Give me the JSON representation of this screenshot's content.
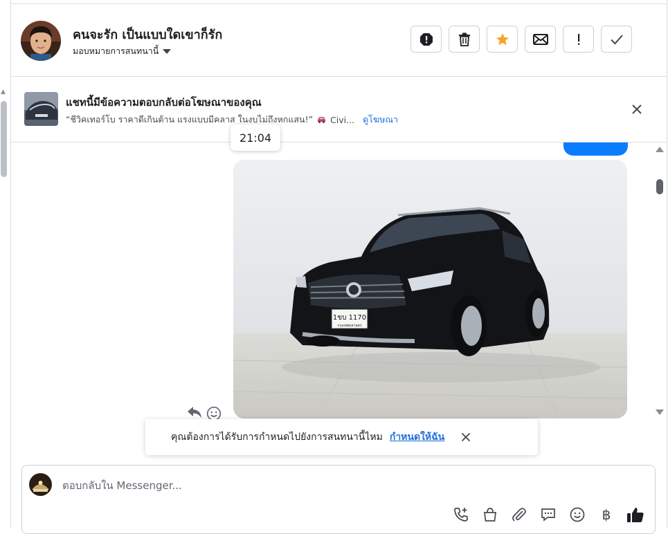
{
  "header": {
    "contact_name": "คนจะรัก เป็นแบบใดเขาก็รัก",
    "assign_label": "มอบหมายการสนทนานี้",
    "actions": [
      {
        "name": "spam",
        "icon": "alert-circle-icon"
      },
      {
        "name": "delete",
        "icon": "trash-icon"
      },
      {
        "name": "star",
        "icon": "star-icon"
      },
      {
        "name": "mark-unread",
        "icon": "envelope-icon"
      },
      {
        "name": "follow-up",
        "icon": "exclamation-icon"
      },
      {
        "name": "done",
        "icon": "check-icon"
      }
    ]
  },
  "ad_banner": {
    "title": "แชทนี้มีข้อความตอบกลับต่อโฆษณาของคุณ",
    "quote": "“ชีวิคเทอร์โบ ราคาดีเกินต้าน แรงแบบมีคลาส ในงบไม่ถึงหกแสน!”",
    "quote_suffix": "Civi...",
    "link": "ดูโฆษณา"
  },
  "conversation": {
    "timestamp": "21:04",
    "photo_plate": "1ขบ 1170",
    "photo_plate_sub": "กรุงเทพมหานคร"
  },
  "assign_prompt": {
    "text": "คุณต้องการได้รับการกำหนดไปยังการสนทนานี้ไหม",
    "link": "กำหนดให้ฉัน"
  },
  "composer": {
    "placeholder": "ตอบกลับใน Messenger...",
    "tools": [
      "call-add-icon",
      "shop-bag-icon",
      "paperclip-icon",
      "saved-reply-icon",
      "emoji-icon",
      "baht-icon",
      "thumbs-up-icon"
    ],
    "baht_symbol": "฿"
  },
  "colors": {
    "accent": "#0a7cff",
    "link": "#216fdb",
    "star": "#f5a623"
  }
}
